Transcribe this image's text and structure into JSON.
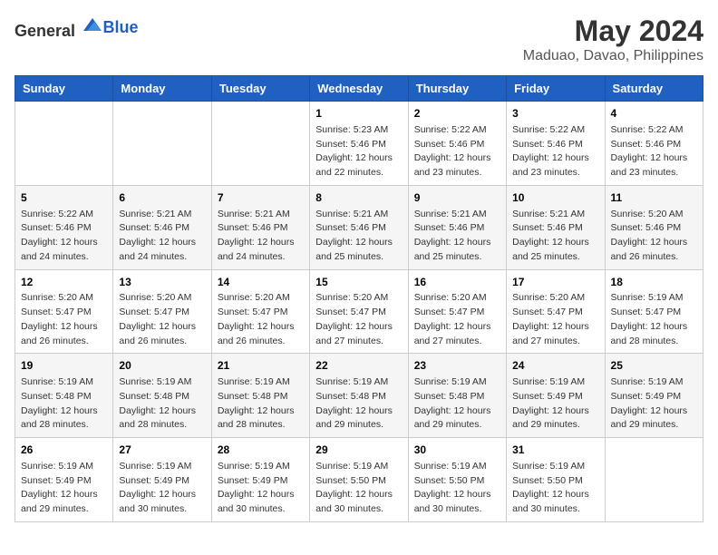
{
  "header": {
    "logo_general": "General",
    "logo_blue": "Blue",
    "month": "May 2024",
    "location": "Maduao, Davao, Philippines"
  },
  "days_of_week": [
    "Sunday",
    "Monday",
    "Tuesday",
    "Wednesday",
    "Thursday",
    "Friday",
    "Saturday"
  ],
  "weeks": [
    [
      {
        "day": "",
        "info": ""
      },
      {
        "day": "",
        "info": ""
      },
      {
        "day": "",
        "info": ""
      },
      {
        "day": "1",
        "info": "Sunrise: 5:23 AM\nSunset: 5:46 PM\nDaylight: 12 hours\nand 22 minutes."
      },
      {
        "day": "2",
        "info": "Sunrise: 5:22 AM\nSunset: 5:46 PM\nDaylight: 12 hours\nand 23 minutes."
      },
      {
        "day": "3",
        "info": "Sunrise: 5:22 AM\nSunset: 5:46 PM\nDaylight: 12 hours\nand 23 minutes."
      },
      {
        "day": "4",
        "info": "Sunrise: 5:22 AM\nSunset: 5:46 PM\nDaylight: 12 hours\nand 23 minutes."
      }
    ],
    [
      {
        "day": "5",
        "info": "Sunrise: 5:22 AM\nSunset: 5:46 PM\nDaylight: 12 hours\nand 24 minutes."
      },
      {
        "day": "6",
        "info": "Sunrise: 5:21 AM\nSunset: 5:46 PM\nDaylight: 12 hours\nand 24 minutes."
      },
      {
        "day": "7",
        "info": "Sunrise: 5:21 AM\nSunset: 5:46 PM\nDaylight: 12 hours\nand 24 minutes."
      },
      {
        "day": "8",
        "info": "Sunrise: 5:21 AM\nSunset: 5:46 PM\nDaylight: 12 hours\nand 25 minutes."
      },
      {
        "day": "9",
        "info": "Sunrise: 5:21 AM\nSunset: 5:46 PM\nDaylight: 12 hours\nand 25 minutes."
      },
      {
        "day": "10",
        "info": "Sunrise: 5:21 AM\nSunset: 5:46 PM\nDaylight: 12 hours\nand 25 minutes."
      },
      {
        "day": "11",
        "info": "Sunrise: 5:20 AM\nSunset: 5:46 PM\nDaylight: 12 hours\nand 26 minutes."
      }
    ],
    [
      {
        "day": "12",
        "info": "Sunrise: 5:20 AM\nSunset: 5:47 PM\nDaylight: 12 hours\nand 26 minutes."
      },
      {
        "day": "13",
        "info": "Sunrise: 5:20 AM\nSunset: 5:47 PM\nDaylight: 12 hours\nand 26 minutes."
      },
      {
        "day": "14",
        "info": "Sunrise: 5:20 AM\nSunset: 5:47 PM\nDaylight: 12 hours\nand 26 minutes."
      },
      {
        "day": "15",
        "info": "Sunrise: 5:20 AM\nSunset: 5:47 PM\nDaylight: 12 hours\nand 27 minutes."
      },
      {
        "day": "16",
        "info": "Sunrise: 5:20 AM\nSunset: 5:47 PM\nDaylight: 12 hours\nand 27 minutes."
      },
      {
        "day": "17",
        "info": "Sunrise: 5:20 AM\nSunset: 5:47 PM\nDaylight: 12 hours\nand 27 minutes."
      },
      {
        "day": "18",
        "info": "Sunrise: 5:19 AM\nSunset: 5:47 PM\nDaylight: 12 hours\nand 28 minutes."
      }
    ],
    [
      {
        "day": "19",
        "info": "Sunrise: 5:19 AM\nSunset: 5:48 PM\nDaylight: 12 hours\nand 28 minutes."
      },
      {
        "day": "20",
        "info": "Sunrise: 5:19 AM\nSunset: 5:48 PM\nDaylight: 12 hours\nand 28 minutes."
      },
      {
        "day": "21",
        "info": "Sunrise: 5:19 AM\nSunset: 5:48 PM\nDaylight: 12 hours\nand 28 minutes."
      },
      {
        "day": "22",
        "info": "Sunrise: 5:19 AM\nSunset: 5:48 PM\nDaylight: 12 hours\nand 29 minutes."
      },
      {
        "day": "23",
        "info": "Sunrise: 5:19 AM\nSunset: 5:48 PM\nDaylight: 12 hours\nand 29 minutes."
      },
      {
        "day": "24",
        "info": "Sunrise: 5:19 AM\nSunset: 5:49 PM\nDaylight: 12 hours\nand 29 minutes."
      },
      {
        "day": "25",
        "info": "Sunrise: 5:19 AM\nSunset: 5:49 PM\nDaylight: 12 hours\nand 29 minutes."
      }
    ],
    [
      {
        "day": "26",
        "info": "Sunrise: 5:19 AM\nSunset: 5:49 PM\nDaylight: 12 hours\nand 29 minutes."
      },
      {
        "day": "27",
        "info": "Sunrise: 5:19 AM\nSunset: 5:49 PM\nDaylight: 12 hours\nand 30 minutes."
      },
      {
        "day": "28",
        "info": "Sunrise: 5:19 AM\nSunset: 5:49 PM\nDaylight: 12 hours\nand 30 minutes."
      },
      {
        "day": "29",
        "info": "Sunrise: 5:19 AM\nSunset: 5:50 PM\nDaylight: 12 hours\nand 30 minutes."
      },
      {
        "day": "30",
        "info": "Sunrise: 5:19 AM\nSunset: 5:50 PM\nDaylight: 12 hours\nand 30 minutes."
      },
      {
        "day": "31",
        "info": "Sunrise: 5:19 AM\nSunset: 5:50 PM\nDaylight: 12 hours\nand 30 minutes."
      },
      {
        "day": "",
        "info": ""
      }
    ]
  ]
}
